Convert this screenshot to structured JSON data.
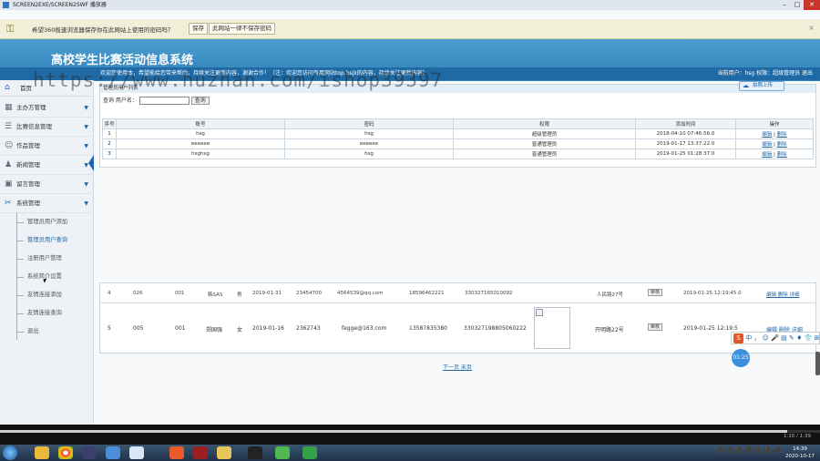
{
  "window": {
    "title": "SCREEN2EXE/SCREEN2SWF 播放器"
  },
  "password_bar": {
    "question": "希望360极速浏览器保存你在此网站上使用的密码吗？",
    "save_label": "保存",
    "never_label": "此网站一律不保存密码",
    "close": "×"
  },
  "header": {
    "system_title": "高校学生比赛活动信息系统",
    "welcome": "欢迎您使用本，希望能给您带来帮助，持续关注更新内容，谢谢合作！（注：欢迎您访问有用网站top.hsjk的内容，持续关注更新内容）",
    "current_user": "当前用户：hsg  权限：超级管理员  退出",
    "watermark": "https://www.huzhan.com/ishop39397"
  },
  "sidebar": {
    "home": "首页",
    "menus": [
      {
        "label": "主办方管理"
      },
      {
        "label": "比赛信息管理"
      },
      {
        "label": "作品管理"
      },
      {
        "label": "新闻管理"
      },
      {
        "label": "留言管理"
      },
      {
        "label": "系统管理"
      }
    ],
    "submenu": [
      {
        "label": "管理员用户添加"
      },
      {
        "label": "管理员用户查询"
      },
      {
        "label": "注册用户管理"
      },
      {
        "label": "系统简介设置"
      },
      {
        "label": "友情连接添加"
      },
      {
        "label": "友情连接查询"
      },
      {
        "label": "退出"
      }
    ]
  },
  "admin_panel": {
    "caption": "管理员用户列表",
    "search_label": "查询 用户名：",
    "search_button": "查询",
    "upload_label": "拍照上传",
    "columns": [
      "序号",
      "账号",
      "密码",
      "权限",
      "添加时间",
      "操作"
    ],
    "rows": [
      {
        "no": "1",
        "account": "hsg",
        "password": "hsg",
        "role": "超级管理员",
        "time": "2018-04-10 07:46:56.0",
        "edit": "编辑",
        "delete": "删除"
      },
      {
        "no": "2",
        "account": "eeeeee",
        "password": "eeeeee",
        "role": "普通管理员",
        "time": "2019-01-17 13:37:22.0",
        "edit": "编辑",
        "delete": "删除"
      },
      {
        "no": "3",
        "account": "hsghsg",
        "password": "hsg",
        "role": "普通管理员",
        "time": "2019-01-25 01:28:37.0",
        "edit": "编辑",
        "delete": "删除"
      }
    ]
  },
  "user_rows": [
    {
      "no": "4",
      "a": "026",
      "b": "001",
      "name": "韩SAS",
      "sex": "男",
      "date": "2019-01-31",
      "phone": "23454700",
      "email": "4564539@qq.com",
      "mobile": "18596462221",
      "idcard": "330327165010092",
      "address": "人民路27号",
      "audit": "审核",
      "time": "2019-01-25 12:19:45.0",
      "ops": "编辑 删除 详细"
    },
    {
      "no": "5",
      "a": "005",
      "b": "001",
      "name": "郑国强",
      "sex": "女",
      "date": "2019-01-16",
      "phone": "2362743",
      "email": "fegge@163.com",
      "mobile": "13587835380",
      "idcard": "330327198805060222",
      "address": "开明路22号",
      "audit": "审核",
      "time": "2019-01-25 12:19:5",
      "ops": "编辑 删除 详细"
    }
  ],
  "pager": {
    "text": "下一页 末页"
  },
  "overlay": {
    "ime": "中 ， ☺ 🎤 ▤ ✎ ♦ 👕 ⊞",
    "timer": "01:25"
  },
  "player": {
    "time": "1:10 / 1:39",
    "progress": 0.96
  },
  "taskbar": {
    "time": "14:39",
    "date": "2020-10-17"
  },
  "colors": {
    "header": "#2e7fb8",
    "link": "#1e66a8",
    "accent_close": "#c8362b"
  }
}
